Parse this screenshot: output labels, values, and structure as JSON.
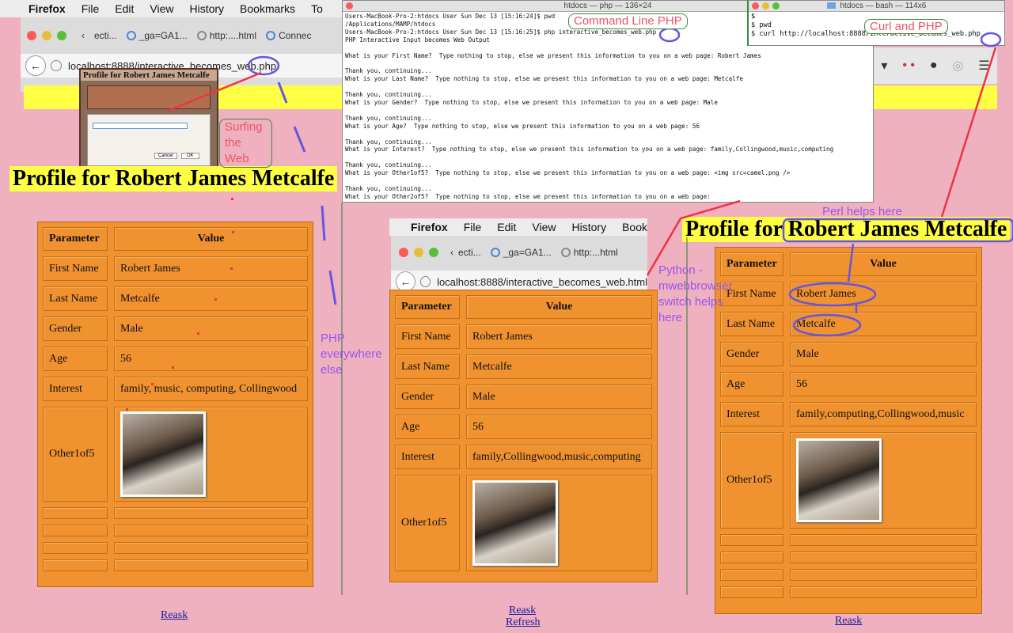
{
  "menubar": {
    "items": [
      "Firefox",
      "File",
      "Edit",
      "View",
      "History",
      "Bookmarks",
      "To"
    ]
  },
  "menubar2": {
    "items": [
      "Firefox",
      "File",
      "Edit",
      "View",
      "History",
      "Book"
    ]
  },
  "browser1": {
    "tabs": [
      "ecti...",
      "_ga=GA1...",
      "http:....html",
      "Connec"
    ],
    "url": "localhost:8888/interactive_becomes_web.php"
  },
  "browser2": {
    "tabs": [
      "ecti...",
      "_ga=GA1...",
      "http:...html"
    ],
    "url": "localhost:8888/interactive_becomes_web.html"
  },
  "terminal1": {
    "title": "htdocs — php — 136×24",
    "lines": [
      "Users-MacBook-Pro-2:htdocs User Sun Dec 13 [15:16:24]$ pwd",
      "/Applications/MAMP/htdocs",
      "Users-MacBook-Pro-2:htdocs User Sun Dec 13 [15:16:25]$ php interactive_becomes_web.php",
      "PHP Interactive Input becomes Web Output",
      "",
      "What is your First Name?  Type nothing to stop, else we present this information to you on a web page: Robert James",
      "",
      "Thank you, continuing...",
      "What is your Last Name?  Type nothing to stop, else we present this information to you on a web page: Metcalfe",
      "",
      "Thank you, continuing...",
      "What is your Gender?  Type nothing to stop, else we present this information to you on a web page: Male",
      "",
      "Thank you, continuing...",
      "What is your Age?  Type nothing to stop, else we present this information to you on a web page: 56",
      "",
      "Thank you, continuing...",
      "What is your Interest?  Type nothing to stop, else we present this information to you on a web page: family,Collingwood,music,computing",
      "",
      "Thank you, continuing...",
      "What is your Other1of5?  Type nothing to stop, else we present this information to you on a web page: <img src=camel.png />",
      "",
      "Thank you, continuing...",
      "What is your Other2of5?  Type nothing to stop, else we present this information to you on a web page:"
    ]
  },
  "terminal2": {
    "title": "htdocs — bash — 114x6",
    "lines": [
      "$",
      "$ pwd",
      "$ curl http://localhost:8888/interactive_becomes_web.php"
    ]
  },
  "heading": {
    "prefix": "Profile for ",
    "name": "Robert James Metcalfe"
  },
  "mini_dialog": {
    "title": "Profile for Robert James Metcalfe",
    "buttons": [
      "Cancel",
      "OK"
    ]
  },
  "table_left": {
    "headers": [
      "Parameter",
      "Value"
    ],
    "rows": [
      [
        "First Name",
        "Robert James"
      ],
      [
        "Last Name",
        "Metcalfe"
      ],
      [
        "Gender",
        "Male"
      ],
      [
        "Age",
        "56"
      ],
      [
        "Interest",
        "family, music, computing, Collingwood"
      ],
      [
        "Other1of5",
        ""
      ]
    ]
  },
  "table_mid": {
    "headers": [
      "Parameter",
      "Value"
    ],
    "rows": [
      [
        "First Name",
        "Robert James"
      ],
      [
        "Last Name",
        "Metcalfe"
      ],
      [
        "Gender",
        "Male"
      ],
      [
        "Age",
        "56"
      ],
      [
        "Interest",
        "family,Collingwood,music,computing"
      ],
      [
        "Other1of5",
        ""
      ]
    ]
  },
  "table_right": {
    "headers": [
      "Parameter",
      "Value"
    ],
    "rows": [
      [
        "First Name",
        "Robert James"
      ],
      [
        "Last Name",
        "Metcalfe"
      ],
      [
        "Gender",
        "Male"
      ],
      [
        "Age",
        "56"
      ],
      [
        "Interest",
        "family,computing,Collingwood,music"
      ],
      [
        "Other1of5",
        ""
      ]
    ]
  },
  "links": {
    "reask": "Reask",
    "refresh": "Refresh"
  },
  "annotations": {
    "command_line": "Command Line PHP",
    "curl": "Curl and PHP",
    "surfing": "Surfing the Web",
    "php_else": "PHP everywhere else",
    "perl": "Perl helps here",
    "python": "Python -mwebbrowser switch helps here"
  },
  "colors": {
    "table_bg": "#f0922f",
    "page_bg": "#efb0c0",
    "heading_bg": "#ffff44",
    "annotation_red": "#ee4455",
    "annotation_purple": "#9955ee"
  }
}
